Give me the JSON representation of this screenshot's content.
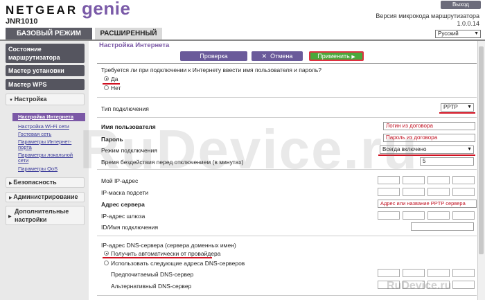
{
  "header": {
    "brand": "NETGEAR",
    "product": "genie",
    "model": "JNR1010",
    "logout": "Выход",
    "firmware_label": "Версия микрокода маршрутизатора",
    "firmware_version": "1.0.0.14",
    "language": "Русский"
  },
  "tabs": {
    "basic": "БАЗОВЫЙ РЕЖИМ",
    "advanced": "РАСШИРЕННЫЙ"
  },
  "sidebar": {
    "status": "Состояние маршрутизатора",
    "setup_wizard": "Мастер установки",
    "wps_wizard": "Мастер WPS",
    "setup": "Настройка",
    "setup_items": [
      "Настройка Интернета",
      "Настройка Wi-Fi сети",
      "Гостевая сеть",
      "Параметры Интернет-порта",
      "Параметры локальной сети",
      "Параметры QoS"
    ],
    "security": "Безопасность",
    "administration": "Администрирование",
    "additional": "Дополнительные настройки"
  },
  "main": {
    "title": "Настройка Интернета",
    "btn_test": "Проверка",
    "btn_cancel": "Отмена",
    "btn_apply": "Применить",
    "login_question": "Требуется ли при подключении к Интернету ввести имя пользователя и пароль?",
    "yes": "Да",
    "no": "Нет",
    "connection_type_label": "Тип подключения",
    "connection_type": "PPTP",
    "username_label": "Имя пользователя",
    "username_value": "Логин из договора",
    "password_label": "Пароль",
    "password_value": "Пароль из договора",
    "conn_mode_label": "Режим подключения",
    "conn_mode_value": "Всегда включено",
    "idle_label": "Время бездействия перед отключением (в минутах)",
    "idle_value": "5",
    "my_ip_label": "Мой IP-адрес",
    "subnet_label": "IP-маска подсети",
    "server_label": "Адрес сервера",
    "server_value": "Адрес или название PPTP сервера",
    "gateway_label": "IP-адрес шлюза",
    "conn_id_label": "ID/Имя подключения",
    "dns_title": "IP-адрес DNS-сервера (сервера доменных имен)",
    "dns_auto": "Получить автоматически от провайдера",
    "dns_manual": "Использовать следующие адреса DNS-серверов",
    "dns_primary": "Предпочитаемый DNS-сервер",
    "dns_secondary": "Альтернативный DNS-сервер"
  },
  "watermark": "RuDevice.ru",
  "watermark_small": "RuDevice.ru"
}
